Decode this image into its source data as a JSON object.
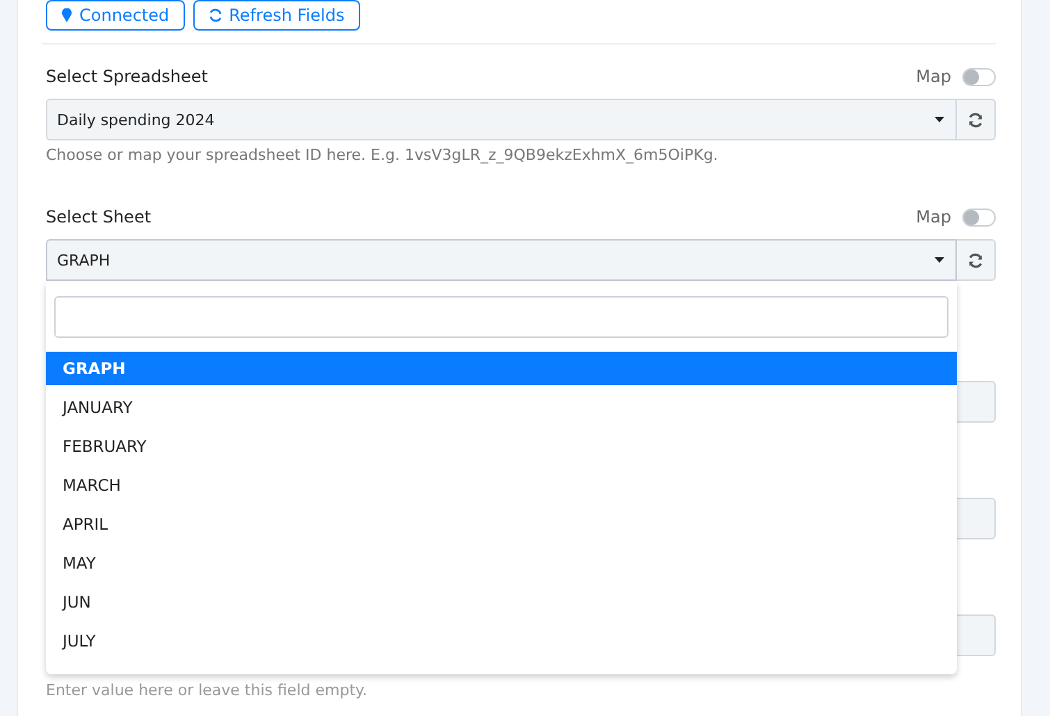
{
  "top_buttons": [
    {
      "label": "Connected",
      "kind": "pin"
    },
    {
      "label": "Refresh Fields",
      "kind": "refresh"
    }
  ],
  "fields": [
    {
      "label": "Select Spreadsheet",
      "map_label": "Map",
      "map_on": false,
      "value": "Daily spending 2024",
      "hint": "Choose or map your spreadsheet ID here. E.g. 1vsV3gLR_z_9QB9ekzExhmX_6m5OiPKg.",
      "open": false
    },
    {
      "label": "Select Sheet",
      "map_label": "Map",
      "map_on": false,
      "value": "GRAPH",
      "open": true
    }
  ],
  "dropdown": {
    "items": [
      {
        "label": "GRAPH",
        "selected": true
      },
      {
        "label": "JANUARY",
        "selected": false
      },
      {
        "label": "FEBRUARY",
        "selected": false
      },
      {
        "label": "MARCH",
        "selected": false
      },
      {
        "label": "APRIL",
        "selected": false
      },
      {
        "label": "MAY",
        "selected": false
      },
      {
        "label": "JUN",
        "selected": false
      },
      {
        "label": "JULY",
        "selected": false
      }
    ]
  },
  "hidden_fields": [
    {
      "kind": "input"
    },
    {
      "kind": "input"
    },
    {
      "kind": "input",
      "hint": "Enter value here or leave this field empty."
    }
  ]
}
